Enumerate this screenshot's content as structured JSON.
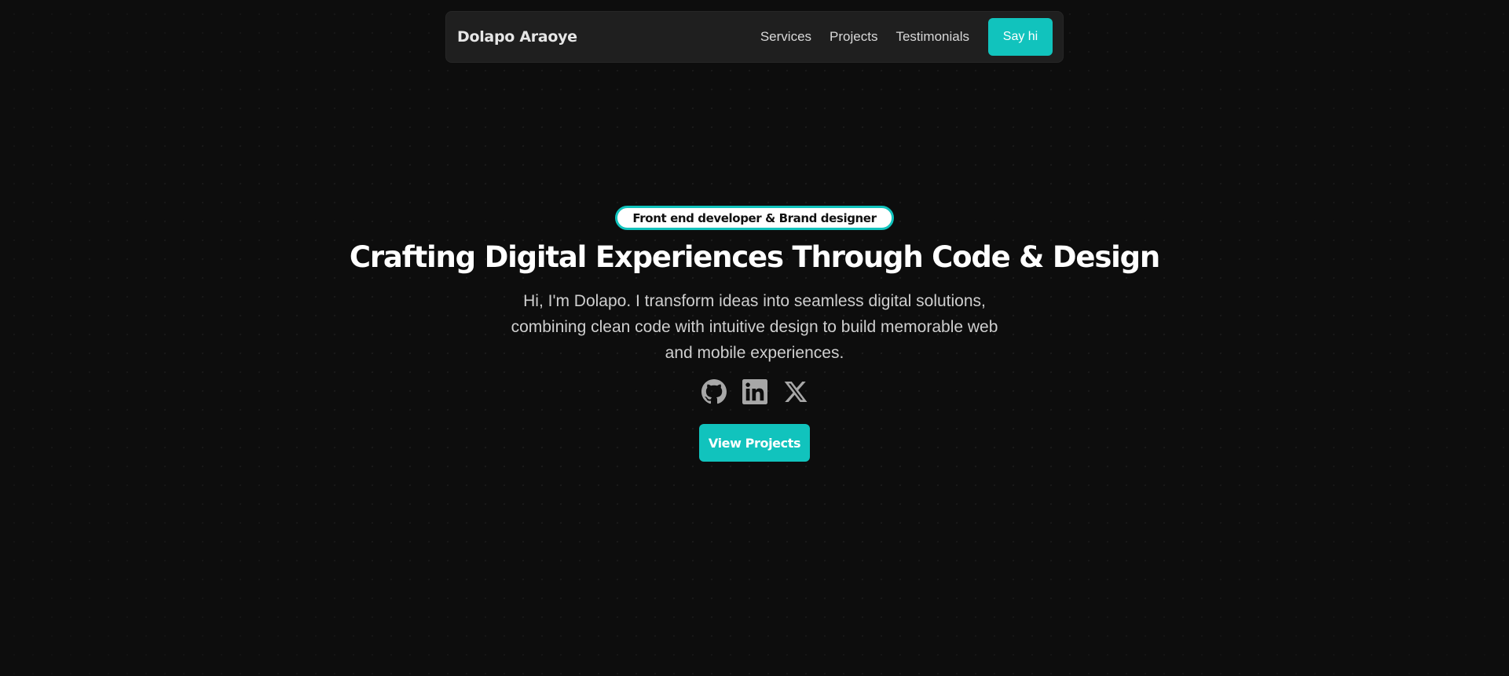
{
  "header": {
    "brand": "Dolapo Araoye",
    "nav": [
      {
        "label": "Services"
      },
      {
        "label": "Projects"
      },
      {
        "label": "Testimonials"
      }
    ],
    "cta_label": "Say hi"
  },
  "hero": {
    "badge": "Front end developer & Brand designer",
    "title": "Crafting Digital Experiences Through Code & Design",
    "intro": "Hi, I'm Dolapo. I transform ideas into seamless digital solutions, combining clean code with intuitive design to build memorable web and mobile experiences.",
    "socials": [
      {
        "icon": "github-icon"
      },
      {
        "icon": "linkedin-icon"
      },
      {
        "icon": "x-icon"
      }
    ],
    "button_label": "View Projects"
  },
  "colors": {
    "accent": "#11c3bd",
    "background": "#0d0d0d",
    "navbar": "#1f1f1f",
    "icon": "#a7a7a7"
  }
}
